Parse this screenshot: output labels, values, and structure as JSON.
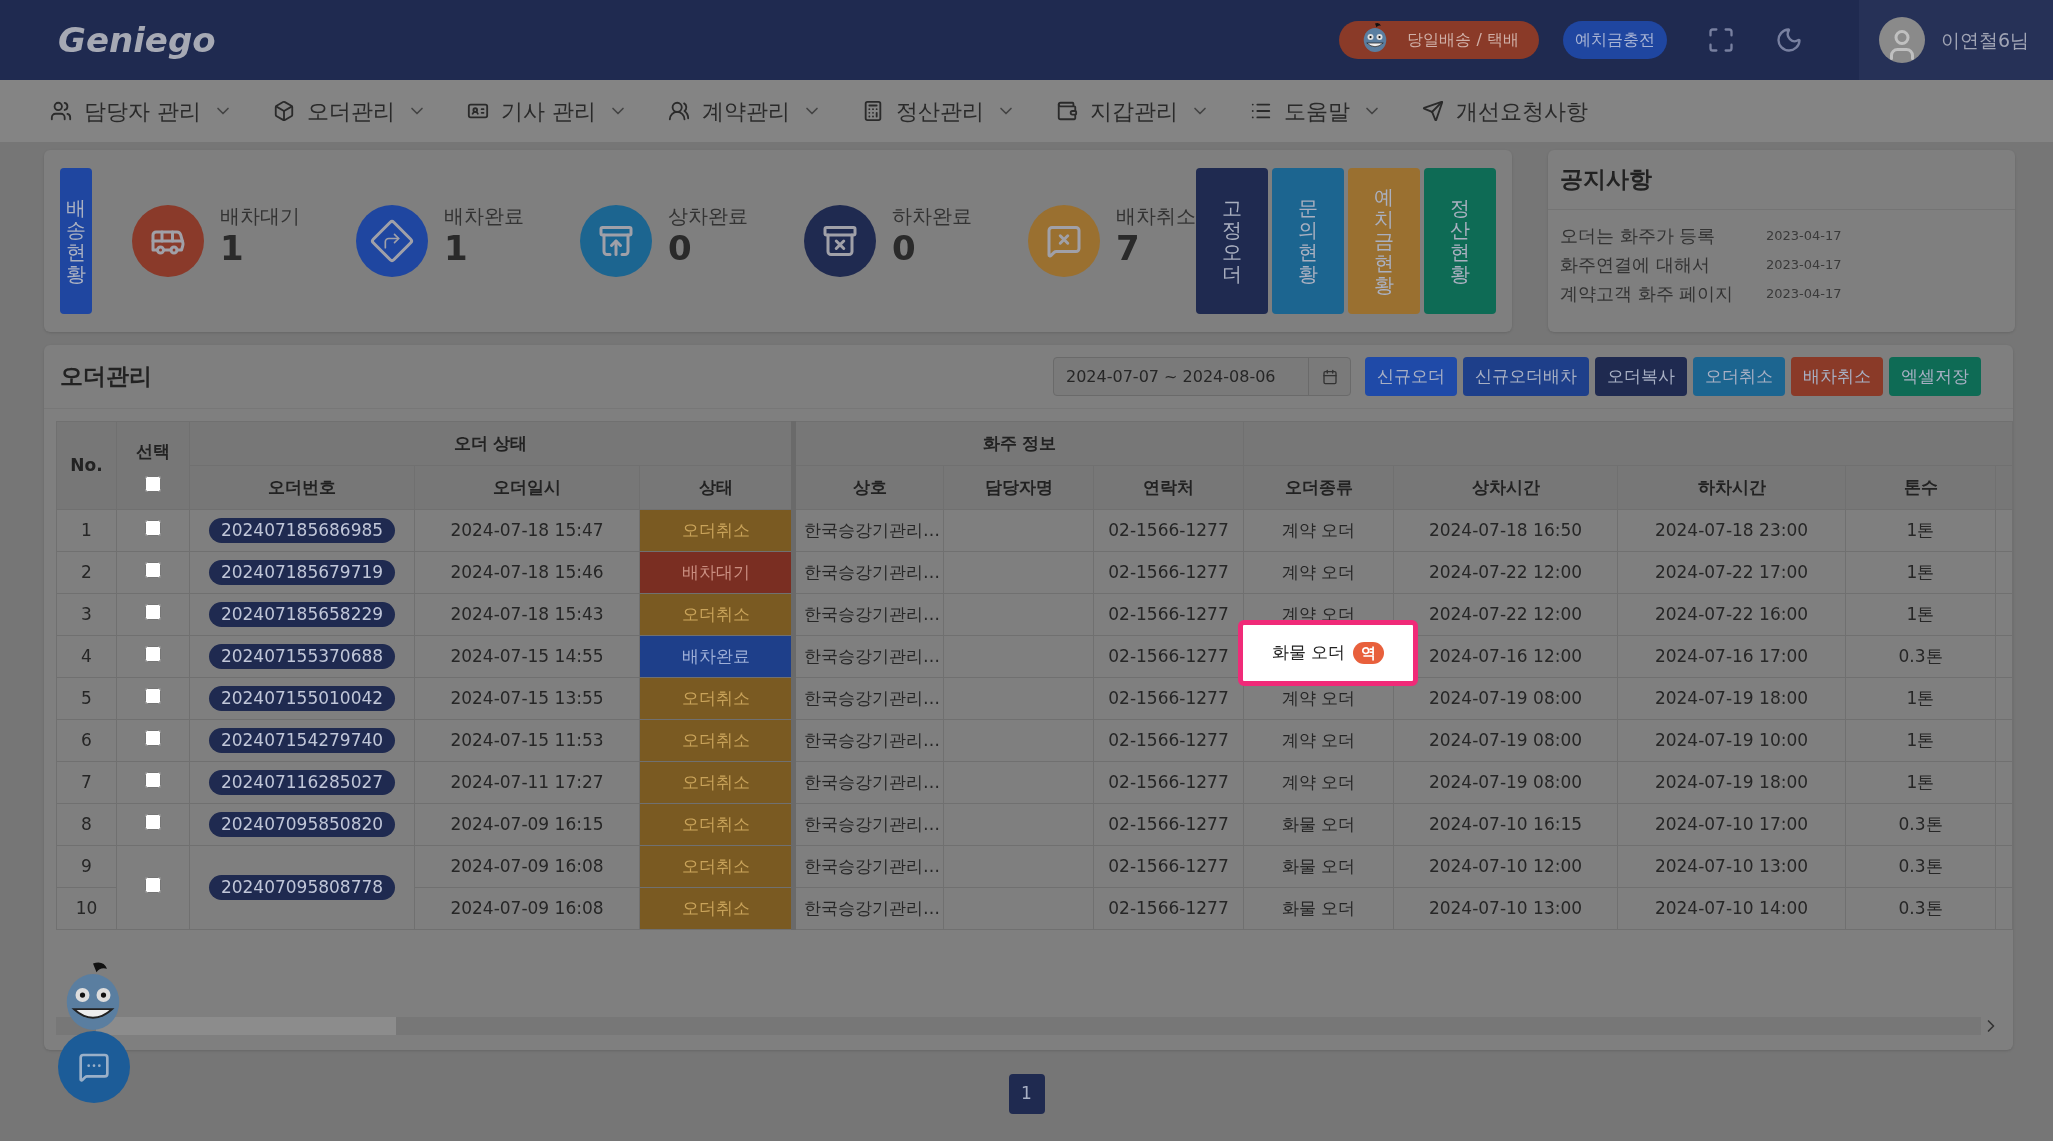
{
  "header": {
    "logo": "Geniego",
    "delivery_button": "당일배송 / 택배",
    "deposit_button": "예치금충전",
    "user_name": "이연철6님"
  },
  "nav": [
    {
      "label": "담당자 관리",
      "kind": "users",
      "dropdown": true
    },
    {
      "label": "오더관리",
      "kind": "box",
      "dropdown": true
    },
    {
      "label": "기사 관리",
      "kind": "card",
      "dropdown": true
    },
    {
      "label": "계약관리",
      "kind": "people",
      "dropdown": true
    },
    {
      "label": "정산관리",
      "kind": "calculator",
      "dropdown": true
    },
    {
      "label": "지갑관리",
      "kind": "wallet",
      "dropdown": true
    },
    {
      "label": "도움말",
      "kind": "list",
      "dropdown": true
    },
    {
      "label": "개선요청사항",
      "kind": "send",
      "dropdown": false
    }
  ],
  "delivery_status": {
    "title": "배송현황",
    "color": "#1f46a0",
    "stats": [
      {
        "label": "배차대기",
        "value": "1",
        "kind": "bus",
        "color": "#8a3a2a"
      },
      {
        "label": "배차완료",
        "value": "1",
        "kind": "route",
        "color": "#1f46a0"
      },
      {
        "label": "상차완료",
        "value": "0",
        "kind": "load",
        "color": "#1c6590"
      },
      {
        "label": "하차완료",
        "value": "0",
        "kind": "unload",
        "color": "#1f2a50"
      },
      {
        "label": "배차취소",
        "value": "7",
        "kind": "cancel",
        "color": "#9a7030"
      }
    ],
    "shortcuts": [
      {
        "label": "고정오더",
        "color": "#1f2a50"
      },
      {
        "label": "문의현황",
        "color": "#1c6590"
      },
      {
        "label": "예치금현황",
        "color": "#9a7030"
      },
      {
        "label": "정산현황",
        "color": "#0e6b55"
      }
    ]
  },
  "notices": {
    "title": "공지사항",
    "items": [
      {
        "title": "오더는 화주가 등록",
        "date": "2023-04-17"
      },
      {
        "title": "화주연결에 대해서",
        "date": "2023-04-17"
      },
      {
        "title": "계약고객 화주 페이지",
        "date": "2023-04-17"
      }
    ]
  },
  "orders": {
    "title": "오더관리",
    "date_range": "2024-07-07 ~ 2024-08-06",
    "buttons": [
      {
        "label": "신규오더",
        "color": "#1f4aa8"
      },
      {
        "label": "신규오더배차",
        "color": "#1e3f8a"
      },
      {
        "label": "오더복사",
        "color": "#1f2a50"
      },
      {
        "label": "오더취소",
        "color": "#1c6590"
      },
      {
        "label": "배차취소",
        "color": "#8a3a28"
      },
      {
        "label": "엑셀저장",
        "color": "#0e6b55"
      }
    ],
    "group_headers": [
      "오더 상태",
      "화주 정보"
    ],
    "no_header": "No.",
    "select_header": "선택",
    "select_all": {
      "checked": false
    },
    "columns": [
      "오더번호",
      "오더일시",
      "상태",
      "상호",
      "담당자명",
      "연락처",
      "오더종류",
      "상차시간",
      "하차시간",
      "톤수"
    ],
    "groups": [
      {
        "checked": false,
        "order_no": "202407185686985",
        "rows": [
          {
            "no": "1",
            "datetime": "2024-07-18 15:47",
            "status": {
              "label": "오더취소",
              "kind": "cancel"
            },
            "company": "한국승강기관리…",
            "phone": "02-1566-1277",
            "order_type": "계약 오더",
            "highlighted": false,
            "load": "2024-07-18 16:50",
            "unload": "2024-07-18 23:00",
            "tons": "1톤"
          }
        ]
      },
      {
        "checked": false,
        "order_no": "202407185679719",
        "rows": [
          {
            "no": "2",
            "datetime": "2024-07-18 15:46",
            "status": {
              "label": "배차대기",
              "kind": "waiting"
            },
            "company": "한국승강기관리…",
            "phone": "02-1566-1277",
            "order_type": "계약 오더",
            "highlighted": false,
            "load": "2024-07-22 12:00",
            "unload": "2024-07-22 17:00",
            "tons": "1톤"
          }
        ]
      },
      {
        "checked": false,
        "order_no": "202407185658229",
        "rows": [
          {
            "no": "3",
            "datetime": "2024-07-18 15:43",
            "status": {
              "label": "오더취소",
              "kind": "cancel"
            },
            "company": "한국승강기관리…",
            "phone": "02-1566-1277",
            "order_type": "계약 오더",
            "highlighted": false,
            "load": "2024-07-22 12:00",
            "unload": "2024-07-22 16:00",
            "tons": "1톤"
          }
        ]
      },
      {
        "checked": false,
        "order_no": "202407155370688",
        "rows": [
          {
            "no": "4",
            "datetime": "2024-07-15 14:55",
            "status": {
              "label": "배차완료",
              "kind": "dispatched"
            },
            "company": "한국승강기관리…",
            "phone": "02-1566-1277",
            "order_type": "화물 오더",
            "badge": "역",
            "highlighted": true,
            "load": "2024-07-16 12:00",
            "unload": "2024-07-16 17:00",
            "tons": "0.3톤"
          }
        ]
      },
      {
        "checked": false,
        "order_no": "202407155010042",
        "rows": [
          {
            "no": "5",
            "datetime": "2024-07-15 13:55",
            "status": {
              "label": "오더취소",
              "kind": "cancel"
            },
            "company": "한국승강기관리…",
            "phone": "02-1566-1277",
            "order_type": "계약 오더",
            "highlighted": false,
            "load": "2024-07-19 08:00",
            "unload": "2024-07-19 18:00",
            "tons": "1톤"
          }
        ]
      },
      {
        "checked": false,
        "order_no": "202407154279740",
        "rows": [
          {
            "no": "6",
            "datetime": "2024-07-15 11:53",
            "status": {
              "label": "오더취소",
              "kind": "cancel"
            },
            "company": "한국승강기관리…",
            "phone": "02-1566-1277",
            "order_type": "계약 오더",
            "highlighted": false,
            "load": "2024-07-19 08:00",
            "unload": "2024-07-19 10:00",
            "tons": "1톤"
          }
        ]
      },
      {
        "checked": false,
        "order_no": "202407116285027",
        "rows": [
          {
            "no": "7",
            "datetime": "2024-07-11 17:27",
            "status": {
              "label": "오더취소",
              "kind": "cancel"
            },
            "company": "한국승강기관리…",
            "phone": "02-1566-1277",
            "order_type": "계약 오더",
            "highlighted": false,
            "load": "2024-07-19 08:00",
            "unload": "2024-07-19 18:00",
            "tons": "1톤"
          }
        ]
      },
      {
        "checked": false,
        "order_no": "202407095850820",
        "rows": [
          {
            "no": "8",
            "datetime": "2024-07-09 16:15",
            "status": {
              "label": "오더취소",
              "kind": "cancel"
            },
            "company": "한국승강기관리…",
            "phone": "02-1566-1277",
            "order_type": "화물 오더",
            "highlighted": false,
            "load": "2024-07-10 16:15",
            "unload": "2024-07-10 17:00",
            "tons": "0.3톤"
          }
        ]
      },
      {
        "checked": false,
        "order_no": "202407095808778",
        "rows": [
          {
            "no": "9",
            "datetime": "2024-07-09 16:08",
            "status": {
              "label": "오더취소",
              "kind": "cancel"
            },
            "company": "한국승강기관리…",
            "phone": "02-1566-1277",
            "order_type": "화물 오더",
            "highlighted": false,
            "load": "2024-07-10 12:00",
            "unload": "2024-07-10 13:00",
            "tons": "0.3톤"
          },
          {
            "no": "10",
            "datetime": "2024-07-09 16:08",
            "status": {
              "label": "오더취소",
              "kind": "cancel"
            },
            "company": "한국승강기관리…",
            "phone": "02-1566-1277",
            "order_type": "화물 오더",
            "highlighted": false,
            "load": "2024-07-10 13:00",
            "unload": "2024-07-10 14:00",
            "tons": "0.3톤"
          }
        ]
      }
    ]
  },
  "pagination": [
    {
      "label": "1",
      "selected": true
    }
  ]
}
